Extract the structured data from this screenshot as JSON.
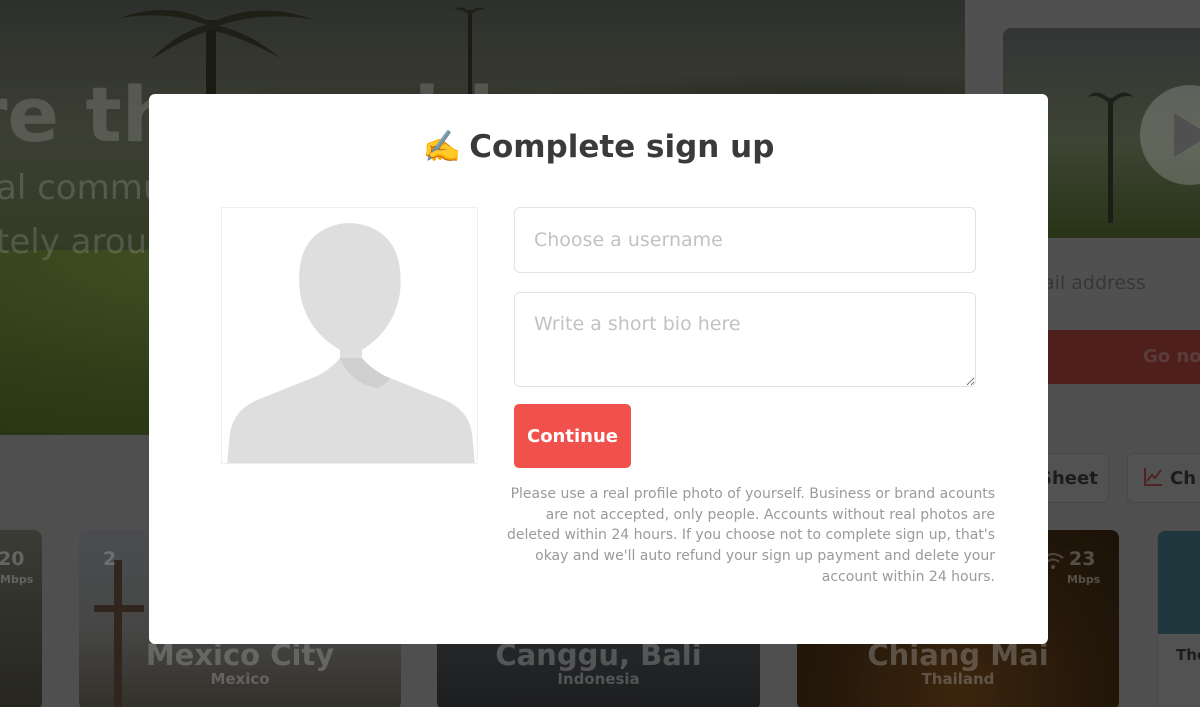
{
  "colors": {
    "accent": "#f0514c",
    "modal_bg": "#ffffff",
    "placeholder": "#c2c2c2",
    "notice_text": "#9a9a9a",
    "title_text": "#3a3a3a"
  },
  "background": {
    "hero_title": "re the world",
    "hero_sub1": "al community",
    "hero_sub2": "tely around",
    "email_placeholder": "ail address",
    "go_button": "Go nomad",
    "filter_chips": [
      {
        "label": "Sheet",
        "icon": ""
      },
      {
        "label": "Ch",
        "icon": "chart-icon"
      }
    ],
    "cities": [
      {
        "name": "",
        "country": "",
        "speed": "20",
        "unit": "Mbps"
      },
      {
        "name": "Mexico City",
        "country": "Mexico",
        "speed": "2",
        "unit": ""
      },
      {
        "name": "Canggu, Bali",
        "country": "Indonesia",
        "speed": "",
        "unit": ""
      },
      {
        "name": "Chiang Mai",
        "country": "Thailand",
        "speed": "23",
        "unit": "Mbps"
      },
      {
        "name": "The",
        "country": "",
        "speed": "",
        "unit": ""
      }
    ]
  },
  "modal": {
    "title_emoji": "✍️",
    "title": "Complete sign up",
    "avatar_icon": "user-silhouette-icon",
    "username_placeholder": "Choose a username",
    "username_value": "",
    "bio_placeholder": "Write a short bio here",
    "bio_value": "",
    "continue_label": "Continue",
    "notice": "Please use a real profile photo of yourself. Business or brand acounts are not accepted, only people. Accounts without real photos are deleted within 24 hours. If you choose not to complete sign up, that's okay and we'll auto refund your sign up payment and delete your account within 24 hours."
  }
}
